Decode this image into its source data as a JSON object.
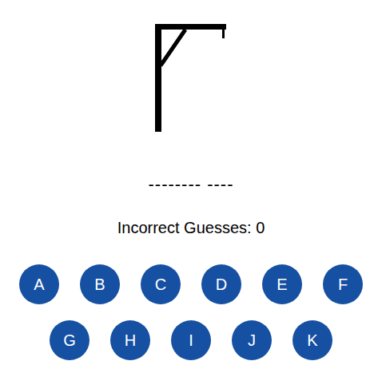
{
  "word_display": "-------- ----",
  "incorrect_guesses": "Incorrect Guesses: 0",
  "keyboard": {
    "rows": [
      [
        "A",
        "B",
        "C",
        "D",
        "E",
        "F"
      ],
      [
        "G",
        "H",
        "I",
        "J",
        "K"
      ]
    ]
  }
}
